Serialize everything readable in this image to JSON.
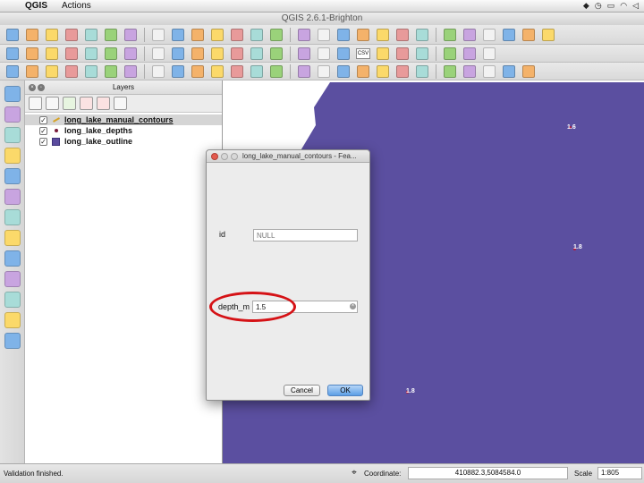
{
  "menubar": {
    "app": "QGIS",
    "items": [
      "Actions"
    ]
  },
  "window": {
    "title": "QGIS 2.6.1-Brighton"
  },
  "toolbars": {
    "row1": [
      "new-project-icon",
      "open-project-icon",
      "save-project-icon",
      "save-as-icon",
      "new-print-composer-icon",
      "composer-manager-icon",
      "pan-map-icon",
      "pan-to-selection-icon",
      "zoom-in-icon",
      "zoom-out-icon",
      "zoom-full-icon",
      "zoom-layer-icon",
      "zoom-selection-icon",
      "zoom-last-icon",
      "zoom-next-icon",
      "refresh-icon",
      "identify-icon",
      "map-tips-icon",
      "select-features-icon",
      "deselect-icon",
      "field-calculator-icon",
      "attribute-table-icon",
      "measure-icon",
      "statistics-icon",
      "annotation-icon",
      "text-annotation-icon",
      "label-icon"
    ],
    "row2": [
      "current-edits-icon",
      "toggle-editing-icon",
      "save-edits-icon",
      "digitize-icon",
      "add-feature-icon",
      "move-feature-icon",
      "node-tool-icon",
      "delete-selected-icon",
      "cut-features-icon",
      "copy-features-icon",
      "paste-features-icon",
      "label-tool-icon",
      "pin-labels-icon",
      "highlight-pinned-icon",
      "move-label-icon",
      "rotate-label-icon",
      "change-label-icon",
      "csv-layer-icon",
      "add-vector-icon",
      "add-raster-icon",
      "add-wms-icon",
      "add-spatialite-icon",
      "add-postgis-icon",
      "grid-icon"
    ],
    "row3": [
      "undo-icon",
      "redo-icon",
      "add-ring-icon",
      "add-part-icon",
      "fill-ring-icon",
      "delete-ring-icon",
      "delete-part-icon",
      "reshape-icon",
      "offset-curve-icon",
      "split-features-icon",
      "split-parts-icon",
      "merge-selected-icon",
      "merge-attributes-icon",
      "rotate-point-icon",
      "simplify-icon",
      "align-icon",
      "rotate-feature-icon",
      "reshape-features-icon",
      "offset-icon",
      "topology-icon",
      "snapping-icon",
      "trace-icon",
      "node-icon",
      "vertex-icon",
      "circle-icon",
      "union-icon"
    ],
    "csv_label": "CSV"
  },
  "left_tools": [
    "add-vector-layer-icon",
    "add-raster-layer-icon",
    "add-postgis-layer-icon",
    "add-spatialite-layer-icon",
    "add-delimited-text-icon",
    "add-wms-layer-icon",
    "add-wcs-layer-icon",
    "add-wfs-layer-icon",
    "new-shapefile-icon",
    "new-spatialite-icon",
    "new-gpx-icon",
    "add-oracle-icon",
    "add-mssql-icon"
  ],
  "layers_panel": {
    "title": "Layers",
    "layers": [
      {
        "name": "long_lake_manual_contours",
        "checked": true,
        "symbol": "line",
        "selected": true
      },
      {
        "name": "long_lake_depths",
        "checked": true,
        "symbol": "point",
        "selected": false
      },
      {
        "name": "long_lake_outline",
        "checked": true,
        "symbol": "fill",
        "selected": false
      }
    ]
  },
  "map": {
    "fill_color": "#5b4fa0",
    "labels": [
      "1.6",
      "1.8",
      "1.8"
    ]
  },
  "dialog": {
    "title": "long_lake_manual_contours - Fea...",
    "fields": [
      {
        "label": "id",
        "value": "NULL"
      },
      {
        "label": "depth_m",
        "value": "1.5"
      }
    ],
    "cancel_label": "Cancel",
    "ok_label": "OK",
    "highlight_color": "#d51216"
  },
  "status": {
    "message": "Validation finished.",
    "coordinate_label": "Coordinate:",
    "coordinate_value": "410882.3,5084584.0",
    "scale_label": "Scale",
    "scale_value": "1:805"
  }
}
